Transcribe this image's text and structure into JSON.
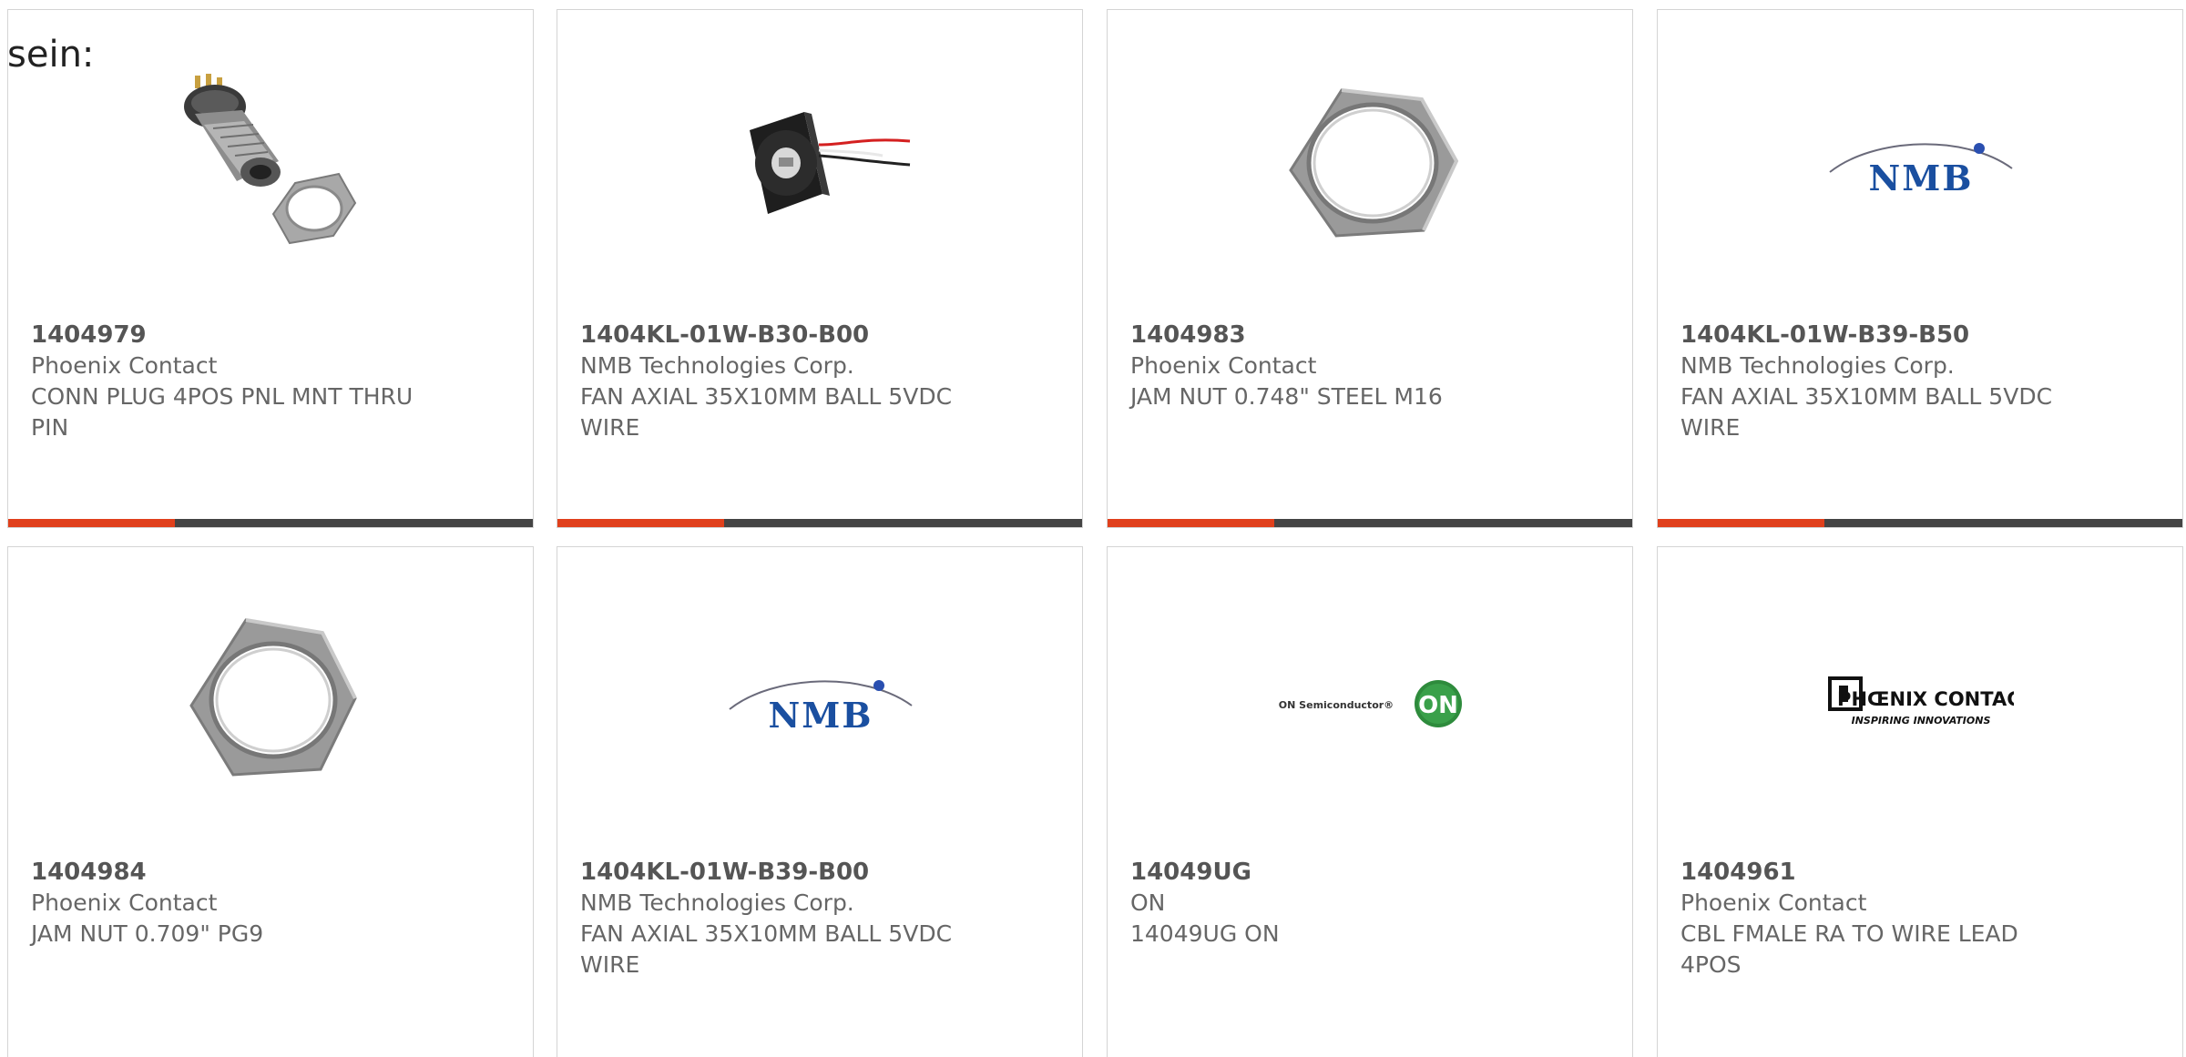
{
  "intro_text": "sein:",
  "products": [
    {
      "part_number": "1404979",
      "manufacturer": "Phoenix Contact",
      "description": "CONN PLUG 4POS PNL MNT THRU PIN",
      "image_icon": "connector-plug-with-nut-photo"
    },
    {
      "part_number": "1404KL-01W-B30-B00",
      "manufacturer": "NMB Technologies Corp.",
      "description": "FAN AXIAL 35X10MM BALL 5VDC WIRE",
      "image_icon": "axial-fan-photo"
    },
    {
      "part_number": "1404983",
      "manufacturer": "Phoenix Contact",
      "description": "JAM NUT 0.748\" STEEL M16",
      "image_icon": "hex-jam-nut-photo"
    },
    {
      "part_number": "1404KL-01W-B39-B50",
      "manufacturer": "NMB Technologies Corp.",
      "description": "FAN AXIAL 35X10MM BALL 5VDC WIRE",
      "image_icon": "nmb-logo",
      "logo_text": "NMB"
    },
    {
      "part_number": "1404984",
      "manufacturer": "Phoenix Contact",
      "description": "JAM NUT 0.709\" PG9",
      "image_icon": "hex-jam-nut-photo"
    },
    {
      "part_number": "1404KL-01W-B39-B00",
      "manufacturer": "NMB Technologies Corp.",
      "description": "FAN AXIAL 35X10MM BALL 5VDC WIRE",
      "image_icon": "nmb-logo",
      "logo_text": "NMB"
    },
    {
      "part_number": "14049UG",
      "manufacturer": "ON",
      "description": "14049UG ON",
      "image_icon": "on-semiconductor-logo",
      "logo_text": "ON Semiconductor®",
      "logo_badge": "ON"
    },
    {
      "part_number": "1404961",
      "manufacturer": "Phoenix Contact",
      "description": "CBL FMALE RA TO WIRE LEAD 4POS",
      "image_icon": "phoenix-contact-logo",
      "logo_text": "PHŒNIX CONTACT",
      "logo_tagline": "INSPIRING INNOVATIONS"
    }
  ],
  "colors": {
    "accent_red": "#e0401c",
    "accent_dark": "#444444",
    "text_gray": "#666666",
    "border": "#d4d4d4",
    "nmb_blue": "#1a4fa0",
    "on_green": "#2e8b3c"
  }
}
